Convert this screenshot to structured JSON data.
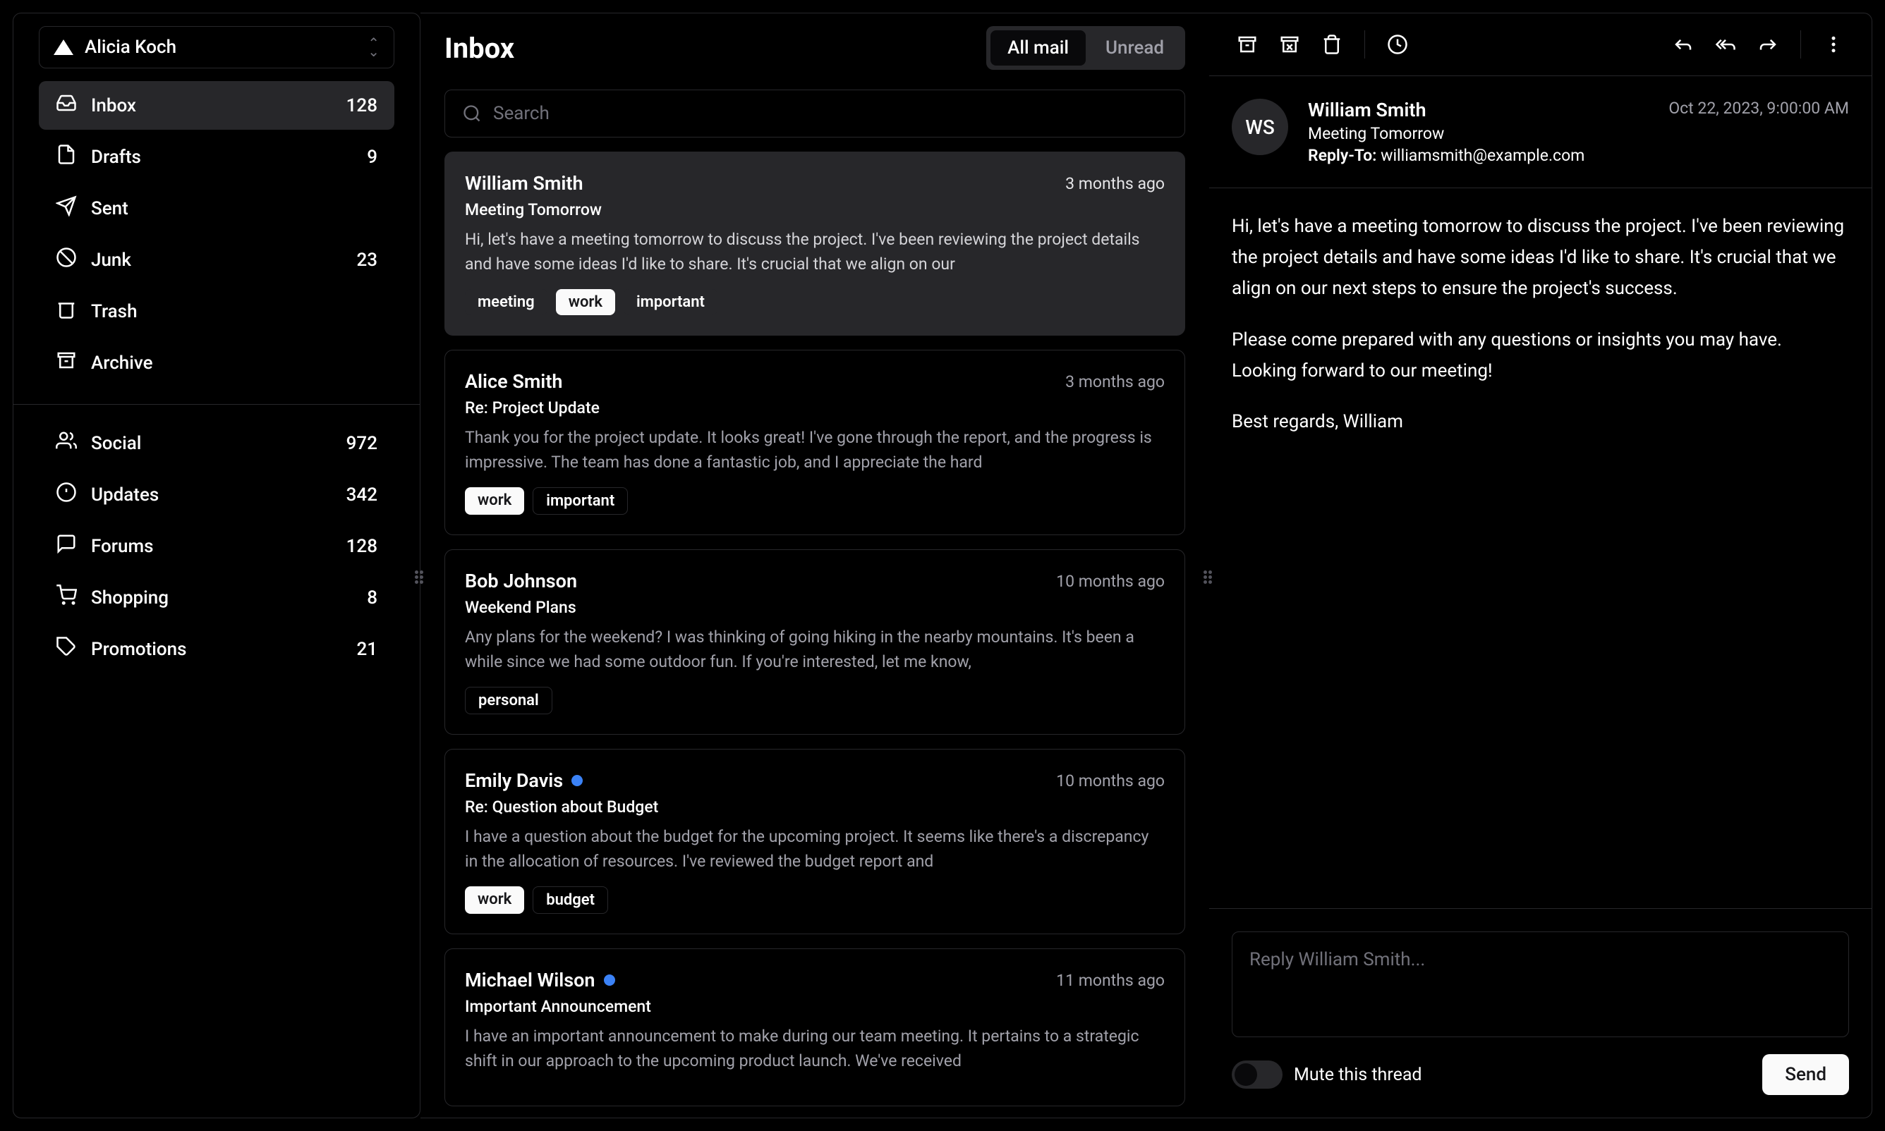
{
  "account": {
    "name": "Alicia Koch"
  },
  "sidebar": {
    "primary": [
      {
        "icon": "inbox",
        "label": "Inbox",
        "count": "128",
        "active": true
      },
      {
        "icon": "file",
        "label": "Drafts",
        "count": "9"
      },
      {
        "icon": "send",
        "label": "Sent",
        "count": ""
      },
      {
        "icon": "junk",
        "label": "Junk",
        "count": "23"
      },
      {
        "icon": "trash",
        "label": "Trash",
        "count": ""
      },
      {
        "icon": "archive",
        "label": "Archive",
        "count": ""
      }
    ],
    "secondary": [
      {
        "icon": "users",
        "label": "Social",
        "count": "972"
      },
      {
        "icon": "alert",
        "label": "Updates",
        "count": "342"
      },
      {
        "icon": "forum",
        "label": "Forums",
        "count": "128"
      },
      {
        "icon": "cart",
        "label": "Shopping",
        "count": "8"
      },
      {
        "icon": "tag",
        "label": "Promotions",
        "count": "21"
      }
    ]
  },
  "inbox": {
    "title": "Inbox",
    "tabs": {
      "all": "All mail",
      "unread": "Unread"
    },
    "search_placeholder": "Search"
  },
  "emails": [
    {
      "sender": "William Smith",
      "subject": "Meeting Tomorrow",
      "time": "3 months ago",
      "preview": "Hi, let's have a meeting tomorrow to discuss the project. I've been reviewing the project details and have some ideas I'd like to share. It's crucial that we align on our",
      "tags": [
        {
          "text": "meeting",
          "style": "dark"
        },
        {
          "text": "work",
          "style": "filled"
        },
        {
          "text": "important",
          "style": "dark"
        }
      ],
      "selected": true,
      "unread": false
    },
    {
      "sender": "Alice Smith",
      "subject": "Re: Project Update",
      "time": "3 months ago",
      "preview": "Thank you for the project update. It looks great! I've gone through the report, and the progress is impressive. The team has done a fantastic job, and I appreciate the hard",
      "tags": [
        {
          "text": "work",
          "style": "filled"
        },
        {
          "text": "important",
          "style": "outline"
        }
      ],
      "unread": false
    },
    {
      "sender": "Bob Johnson",
      "subject": "Weekend Plans",
      "time": "10 months ago",
      "preview": "Any plans for the weekend? I was thinking of going hiking in the nearby mountains. It's been a while since we had some outdoor fun. If you're interested, let me know,",
      "tags": [
        {
          "text": "personal",
          "style": "outline"
        }
      ],
      "unread": false
    },
    {
      "sender": "Emily Davis",
      "subject": "Re: Question about Budget",
      "time": "10 months ago",
      "preview": "I have a question about the budget for the upcoming project. It seems like there's a discrepancy in the allocation of resources. I've reviewed the budget report and",
      "tags": [
        {
          "text": "work",
          "style": "filled"
        },
        {
          "text": "budget",
          "style": "outline"
        }
      ],
      "unread": true
    },
    {
      "sender": "Michael Wilson",
      "subject": "Important Announcement",
      "time": "11 months ago",
      "preview": "I have an important announcement to make during our team meeting. It pertains to a strategic shift in our approach to the upcoming product launch. We've received",
      "tags": [],
      "unread": true
    }
  ],
  "detail": {
    "avatar": "WS",
    "from": "William Smith",
    "subject": "Meeting Tomorrow",
    "reply_to_label": "Reply-To:",
    "reply_to": "williamsmith@example.com",
    "date": "Oct 22, 2023, 9:00:00 AM",
    "body": [
      "Hi, let's have a meeting tomorrow to discuss the project. I've been reviewing the project details and have some ideas I'd like to share. It's crucial that we align on our next steps to ensure the project's success.",
      "Please come prepared with any questions or insights you may have. Looking forward to our meeting!",
      "Best regards, William"
    ],
    "reply_placeholder": "Reply William Smith...",
    "mute_label": "Mute this thread",
    "send_label": "Send"
  }
}
